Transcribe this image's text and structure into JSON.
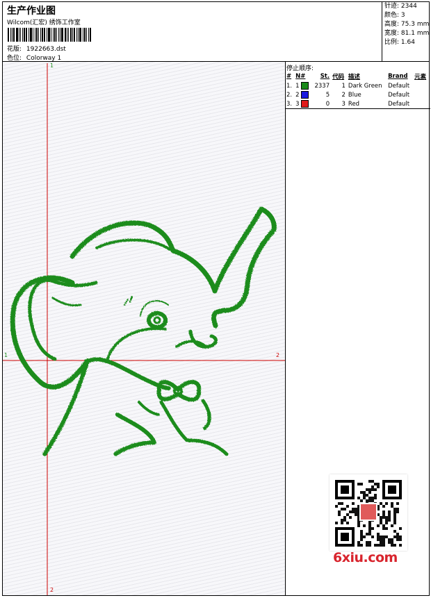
{
  "header": {
    "title": "生产作业图",
    "subtitle": "Wilcom(汇宏) 绣饰工作室",
    "design_label": "花版:",
    "design_value": "1922663.dst",
    "colorway_label": "色位:",
    "colorway_value": "Colorway 1"
  },
  "stats": {
    "stitches_label": "针迹:",
    "stitches_value": "2344",
    "colors_label": "颜色:",
    "colors_value": "3",
    "height_label": "高度:",
    "height_value": "75.3 mm",
    "width_label": "宽度:",
    "width_value": "81.1 mm",
    "ratio_label": "比例:",
    "ratio_value": "1.64"
  },
  "stop_sequence": {
    "caption": "停止顺序:",
    "columns": [
      "#",
      "N#",
      "St.",
      "代码",
      "描述",
      "Brand",
      "元素"
    ],
    "rows": [
      {
        "num": "1.",
        "n": "1",
        "color": "#1a8a1a",
        "st": "2337",
        "code": "1",
        "desc": "Dark Green",
        "brand": "Default"
      },
      {
        "num": "2.",
        "n": "2",
        "color": "#1a1ae0",
        "st": "5",
        "code": "2",
        "desc": "Blue",
        "brand": "Default"
      },
      {
        "num": "3.",
        "n": "3",
        "color": "#e01a1a",
        "st": "0",
        "code": "3",
        "desc": "Red",
        "brand": "Default"
      }
    ]
  },
  "axes": {
    "v_top": "1",
    "v_bottom": "2",
    "h_left": "1",
    "h_right": "2"
  },
  "watermark": "6xiu.com",
  "colors": {
    "thread": "#1f8c1f",
    "crosshair": "#cc0000"
  }
}
